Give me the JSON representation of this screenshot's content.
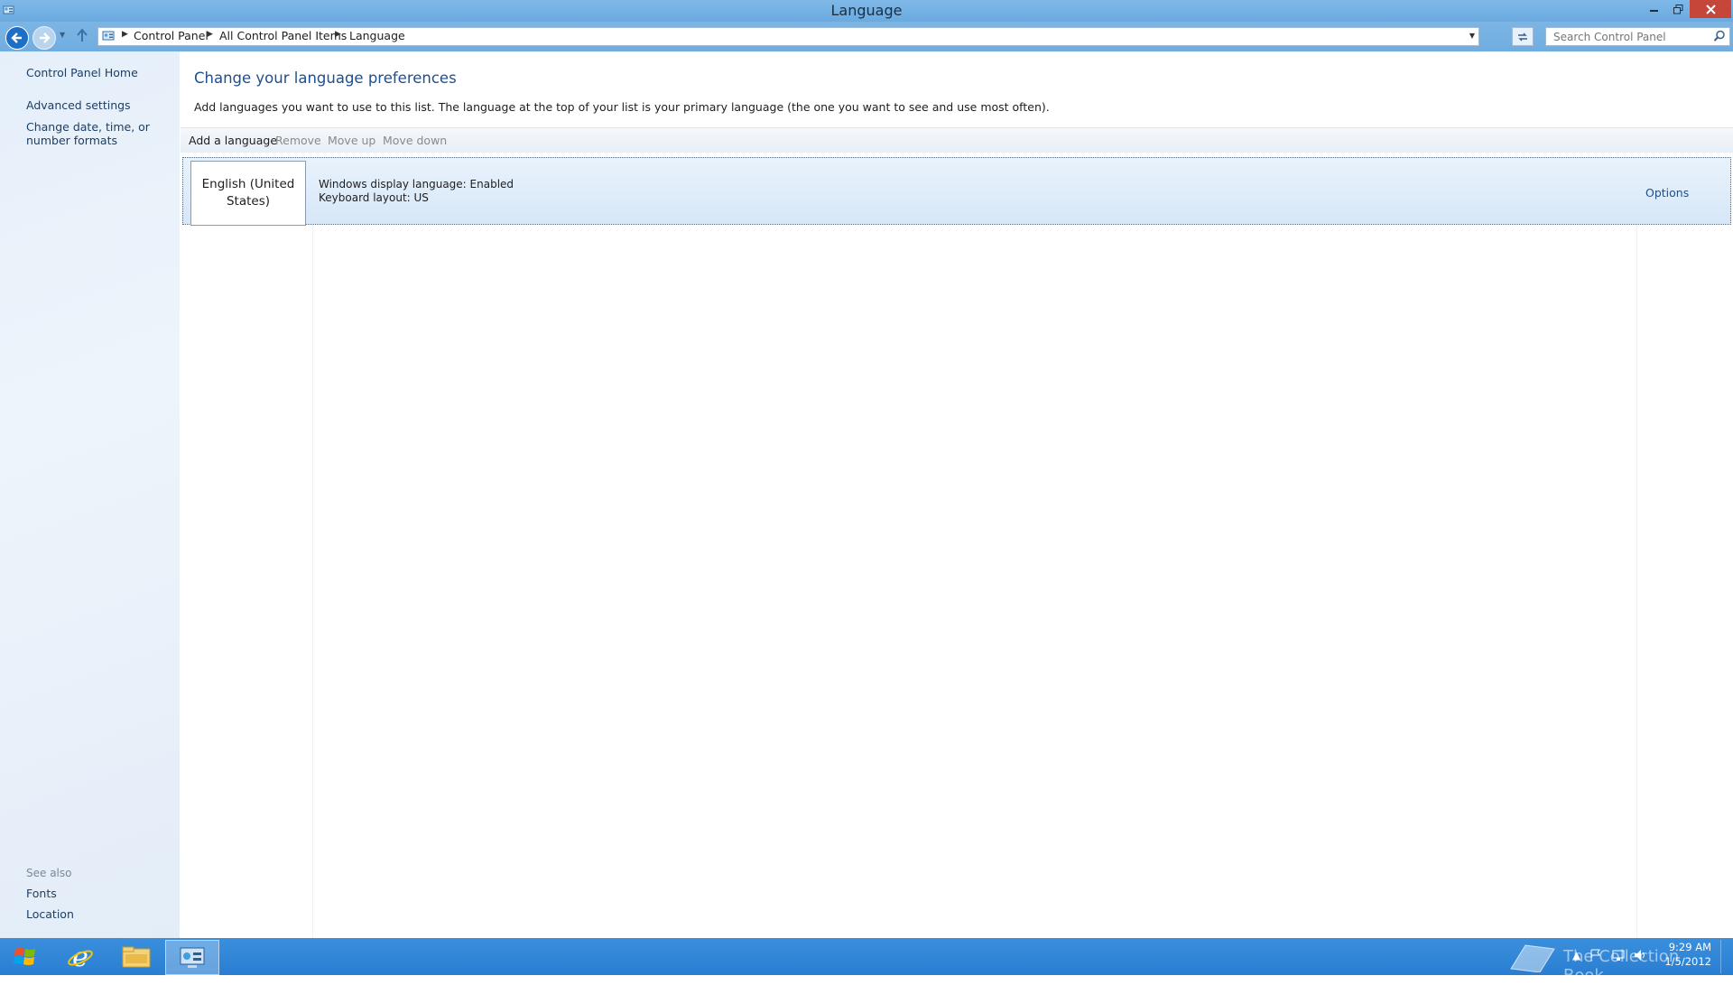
{
  "window": {
    "title": "Language",
    "icons": {
      "app": "control-panel-icon",
      "minimize": "minimize-icon",
      "maximize": "restore-icon",
      "close": "close-icon"
    }
  },
  "nav": {
    "breadcrumbs": [
      "Control Panel",
      "All Control Panel Items",
      "Language"
    ],
    "search_placeholder": "Search Control Panel",
    "icons": {
      "back": "back-arrow-icon",
      "forward": "forward-arrow-icon",
      "up": "up-arrow-icon",
      "refresh": "refresh-icon",
      "search": "search-icon"
    }
  },
  "sidebar": {
    "items": [
      {
        "label": "Control Panel Home"
      },
      {
        "label": "Advanced settings"
      },
      {
        "label": "Change date, time, or number formats"
      }
    ],
    "see_also_label": "See also",
    "see_also": [
      {
        "label": "Fonts"
      },
      {
        "label": "Location"
      }
    ]
  },
  "main": {
    "title": "Change your language preferences",
    "description": "Add languages you want to use to this list. The language at the top of your list is your primary language (the one you want to see and use most often).",
    "toolbar": {
      "add": "Add a language",
      "remove": "Remove",
      "move_up": "Move up",
      "move_down": "Move down"
    },
    "languages": [
      {
        "name": "English (United States)",
        "display_status": "Windows display language: Enabled",
        "keyboard": "Keyboard layout: US",
        "options_label": "Options"
      }
    ]
  },
  "taskbar": {
    "apps": [
      "internet-explorer-icon",
      "file-explorer-icon",
      "control-panel-icon"
    ],
    "watermark": "The Collection Book",
    "time": "9:29 AM",
    "date": "1/5/2012",
    "colors": {
      "taskbar": "#2a7ed2",
      "accent": "#1e4f8f"
    }
  }
}
